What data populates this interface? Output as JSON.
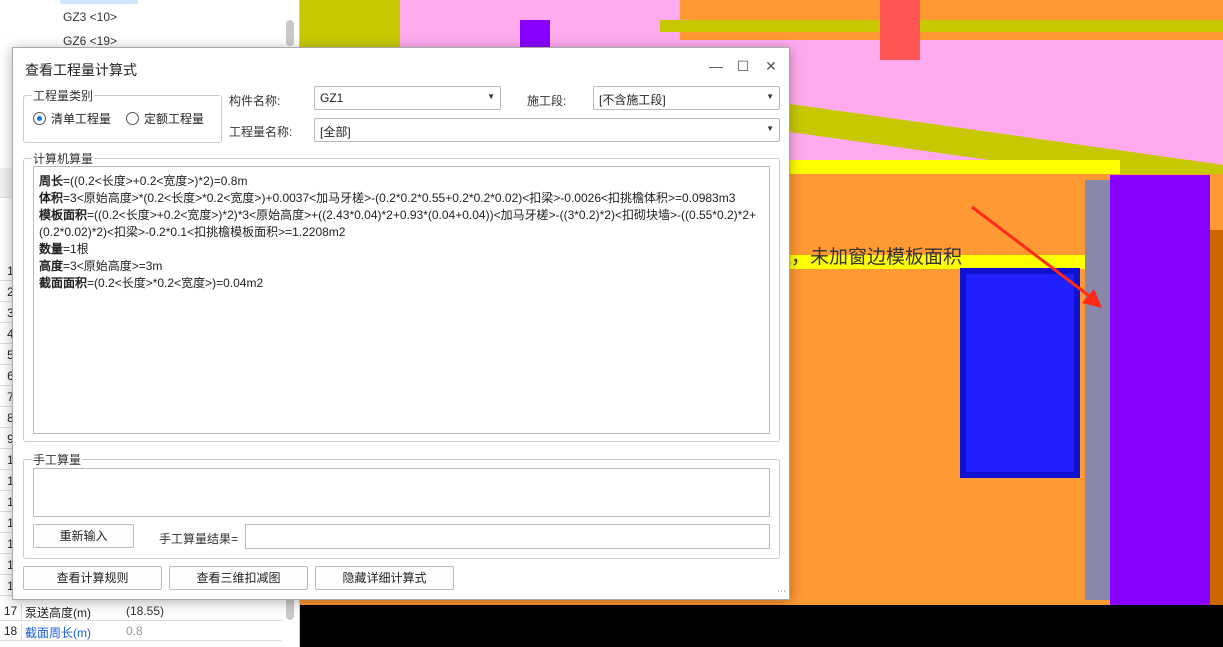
{
  "tree": {
    "items": [
      "GZ3 <10>",
      "GZ6 <19>"
    ]
  },
  "grid": {
    "row_numbers": [
      "1",
      "2",
      "3",
      "4",
      "5",
      "6",
      "7",
      "8",
      "9",
      "1",
      "1",
      "1",
      "1",
      "1",
      "1",
      "1"
    ],
    "rows": [
      {
        "no": "17",
        "key": "泵送高度(m)",
        "value": "(18.55)",
        "key_color": "#333333"
      },
      {
        "no": "18",
        "key": "截面周长(m)",
        "value": "0.8",
        "key_color": "#1a5fd6"
      }
    ]
  },
  "dialog": {
    "title": "查看工程量计算式",
    "minimize_icon": "minimize-icon",
    "maximize_icon": "maximize-icon",
    "close_icon": "close-icon",
    "category": {
      "legend": "工程量类别",
      "options": [
        {
          "label": "清单工程量",
          "selected": true
        },
        {
          "label": "定额工程量",
          "selected": false
        }
      ]
    },
    "component_label": "构件名称:",
    "component_value": "GZ1",
    "stage_label": "施工段:",
    "stage_value": "[不含施工段]",
    "quantity_label": "工程量名称:",
    "quantity_value": "[全部]",
    "computer": {
      "legend": "计算机算量",
      "lines": [
        {
          "name": "周长",
          "formula": "=((0.2<长度>+0.2<宽度>)*2)=0.8m"
        },
        {
          "name": "体积",
          "formula": "=3<原始高度>*(0.2<长度>*0.2<宽度>)+0.0037<加马牙槎>-(0.2*0.2*0.55+0.2*0.2*0.02)<扣梁>-0.0026<扣挑檐体积>=0.0983m3"
        },
        {
          "name": "模板面积",
          "formula": "=((0.2<长度>+0.2<宽度>)*2)*3<原始高度>+((2.43*0.04)*2+0.93*(0.04+0.04))<加马牙槎>-((3*0.2)*2)<扣砌块墙>-((0.55*0.2)*2+(0.2*0.02)*2)<扣梁>-0.2*0.1<扣挑檐模板面积>=1.2208m2"
        },
        {
          "name": "数量",
          "formula": "=1根"
        },
        {
          "name": "高度",
          "formula": "=3<原始高度>=3m"
        },
        {
          "name": "截面面积",
          "formula": "=(0.2<长度>*0.2<宽度>)=0.04m2"
        }
      ]
    },
    "manual": {
      "legend": "手工算量",
      "value": "",
      "reenter": "重新输入",
      "result_label": "手工算量结果=",
      "result_value": ""
    },
    "buttons": {
      "rules": "查看计算规则",
      "view3d": "查看三维扣减图",
      "hide": "隐藏详细计算式"
    }
  },
  "annotation": {
    "text": "这根构造柱在窗子边，未加窗边模板面积",
    "arrow_color": "#ff2a1a"
  }
}
